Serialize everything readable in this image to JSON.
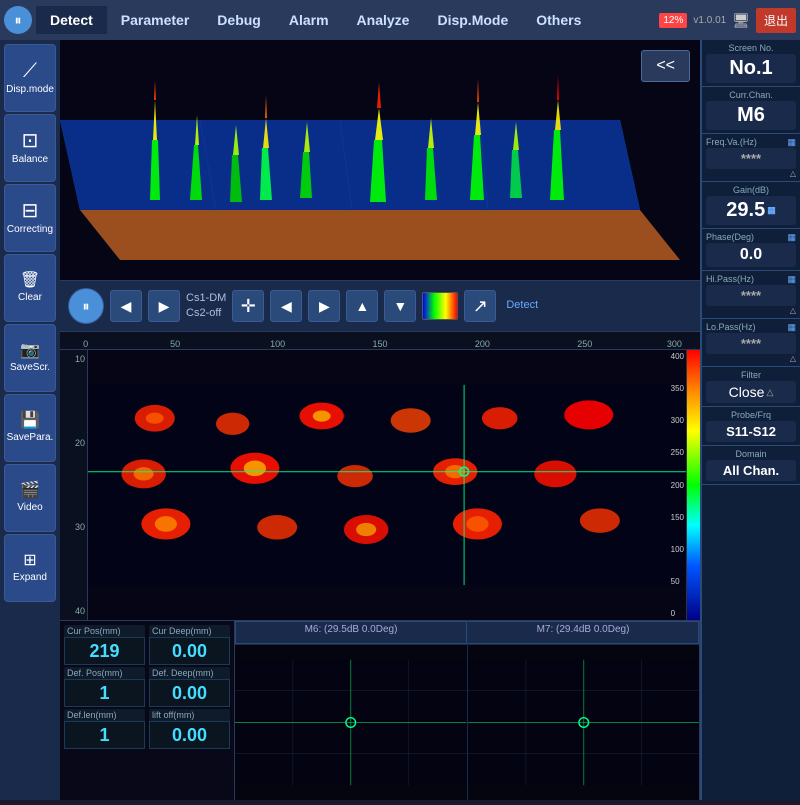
{
  "menubar": {
    "active_item": "Detect",
    "items": [
      "Detect",
      "Parameter",
      "Debug",
      "Alarm",
      "Analyze",
      "Disp.Mode",
      "Others"
    ],
    "battery": "12%",
    "version": "v1.0.01",
    "exit_label": "退出",
    "back_label": "<<"
  },
  "sidebar_left": {
    "items": [
      {
        "id": "disp-mode",
        "label": "Disp.mode",
        "icon": "⟋"
      },
      {
        "id": "balance",
        "label": "Balance",
        "icon": "⊡"
      },
      {
        "id": "correcting",
        "label": "Correcting",
        "icon": "⊟"
      },
      {
        "id": "clear",
        "label": "Clear",
        "icon": "🗑"
      },
      {
        "id": "savescr",
        "label": "SaveScr.",
        "icon": "📷"
      },
      {
        "id": "savepara",
        "label": "SavePara.",
        "icon": "💾"
      },
      {
        "id": "video",
        "label": "Video",
        "icon": "▶"
      },
      {
        "id": "expand",
        "label": "Expand",
        "icon": "⊞"
      }
    ]
  },
  "controls": {
    "cs1_label": "Cs1-DM",
    "cs2_label": "Cs2-off",
    "detect_label": "Detect"
  },
  "ruler_top": {
    "ticks": [
      "0",
      "50",
      "100",
      "150",
      "200",
      "250",
      "300"
    ]
  },
  "ruler_left": {
    "ticks": [
      "10",
      "20",
      "30",
      "40"
    ]
  },
  "ruler_right": {
    "ticks": [
      "400",
      "350",
      "300",
      "250",
      "200",
      "150",
      "100",
      "50",
      "0"
    ]
  },
  "data_panel": {
    "cur_pos_label": "Cur Pos(mm)",
    "cur_pos_value": "219",
    "cur_deep_label": "Cur Deep(mm)",
    "cur_deep_value": "0.00",
    "def_pos_label": "Def. Pos(mm)",
    "def_pos_value": "1",
    "def_deep_label": "Def. Deep(mm)",
    "def_deep_value": "0.00",
    "def_len_label": "Def.len(mm)",
    "def_len_value": "1",
    "lift_off_label": "lift off(mm)",
    "lift_off_value": "0.00"
  },
  "channels": {
    "m6_label": "M6: (29.5dB 0.0Deg)",
    "m7_label": "M7: (29.4dB 0.0Deg)"
  },
  "right_panel": {
    "screen_no_label": "Screen No.",
    "screen_no_value": "No.1",
    "curr_chan_label": "Curr.Chan.",
    "curr_chan_value": "M6",
    "freq_va_label": "Freq.Va.(Hz)",
    "freq_va_value": "****",
    "gain_db_label": "Gain(dB)",
    "gain_db_value": "29.5",
    "phase_deg_label": "Phase(Deg)",
    "phase_deg_value": "0.0",
    "hi_pass_label": "Hi.Pass(Hz)",
    "hi_pass_value": "****",
    "lo_pass_label": "Lo.Pass(Hz)",
    "lo_pass_value": "****",
    "filter_label": "Filter",
    "filter_value": "Close",
    "probe_frq_label": "Probe/Frq",
    "probe_frq_value": "S11-S12",
    "domain_label": "Domain",
    "domain_value": "All Chan."
  }
}
